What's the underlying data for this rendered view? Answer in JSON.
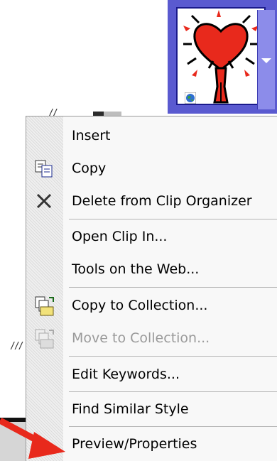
{
  "menu": {
    "items": [
      {
        "label": "Insert",
        "icon": "none",
        "enabled": true
      },
      {
        "label": "Copy",
        "icon": "copy-icon",
        "enabled": true
      },
      {
        "label": "Delete from Clip Organizer",
        "icon": "delete-x-icon",
        "enabled": true
      },
      {
        "label": "Open Clip In...",
        "icon": "none",
        "enabled": true
      },
      {
        "label": "Tools on the Web...",
        "icon": "none",
        "enabled": true
      },
      {
        "label": "Copy to Collection...",
        "icon": "copy-to-collection-icon",
        "enabled": true
      },
      {
        "label": "Move to Collection...",
        "icon": "move-to-collection-icon",
        "enabled": false
      },
      {
        "label": "Edit Keywords...",
        "icon": "none",
        "enabled": true
      },
      {
        "label": "Find Similar Style",
        "icon": "none",
        "enabled": true
      },
      {
        "label": "Preview/Properties",
        "icon": "none",
        "enabled": true
      }
    ]
  },
  "clip": {
    "subject": "heart-figure-clipart",
    "badge": "web-globe-icon"
  },
  "colors": {
    "selection_border": "#5a5ad0",
    "arrow": "#e8291c",
    "heart": "#e8291c"
  }
}
